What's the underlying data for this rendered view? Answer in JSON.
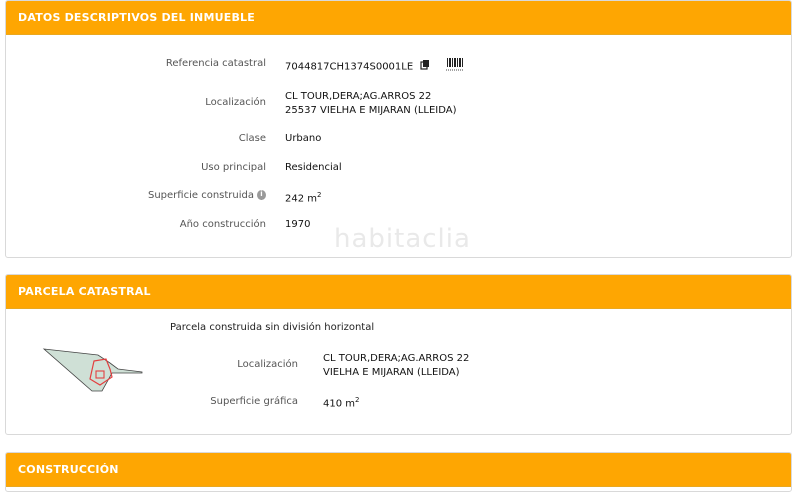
{
  "inmueble": {
    "header": "DATOS DESCRIPTIVOS DEL INMUEBLE",
    "rows": [
      {
        "label": "Referencia catastral",
        "value": "7044817CH1374S0001LE"
      },
      {
        "label": "Localización",
        "value": "CL TOUR,DERA;AG.ARROS 22",
        "value2": "25537 VIELHA E MIJARAN (LLEIDA)"
      },
      {
        "label": "Clase",
        "value": "Urbano"
      },
      {
        "label": "Uso principal",
        "value": "Residencial"
      },
      {
        "label": "Superficie construida",
        "value": "242 m",
        "sup": "2"
      },
      {
        "label": "Año construcción",
        "value": "1970"
      }
    ],
    "icons": [
      "copy-icon",
      "barcode-icon",
      "info-icon"
    ],
    "watermark": "habitaclia"
  },
  "parcela": {
    "header": "PARCELA CATASTRAL",
    "subtitle": "Parcela construida sin división horizontal",
    "rows": [
      {
        "label": "Localización",
        "value": "CL TOUR,DERA;AG.ARROS 22",
        "value2": "VIELHA E MIJARAN (LLEIDA)"
      },
      {
        "label": "Superficie gráfica",
        "value": "410 m",
        "sup": "2"
      }
    ]
  },
  "construccion": {
    "header": "CONSTRUCCIÓN"
  },
  "colors": {
    "accent": "#fea602",
    "border": "#d9d9d9",
    "plot_fill": "#cfe0d6",
    "building": "#e34040"
  }
}
